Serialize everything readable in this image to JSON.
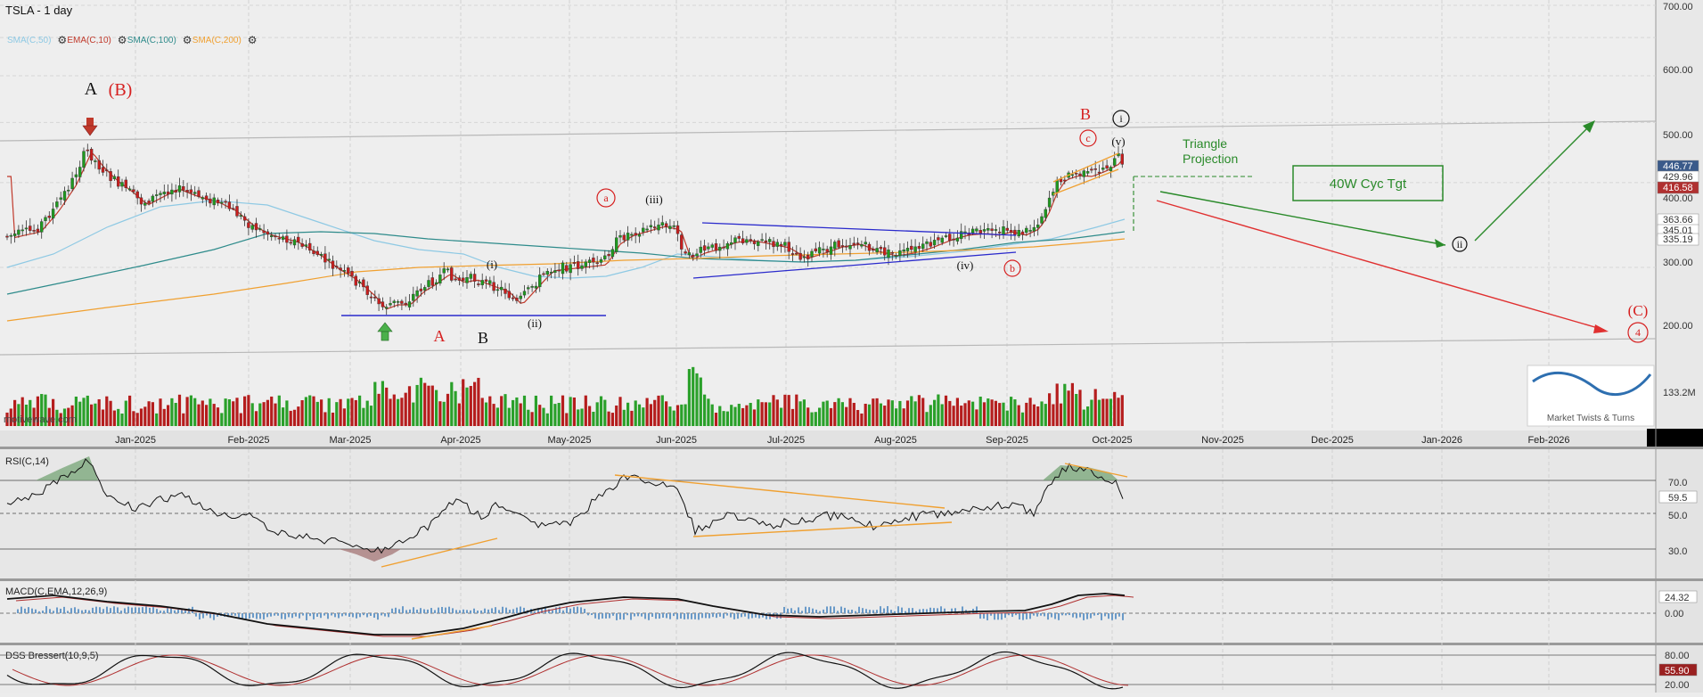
{
  "header": {
    "title": "TSLA - 1 day"
  },
  "indicators_legend": [
    {
      "label": "SMA(C,50)",
      "color": "#8ec9e4",
      "gear": false
    },
    {
      "label": "EMA(C,10)",
      "color": "#c0392b",
      "gear": true
    },
    {
      "label": "SMA(C,100)",
      "color": "#2e8b8b",
      "gear": true
    },
    {
      "label": "SMA(C,200)",
      "color": "#f0a030",
      "gear": true
    }
  ],
  "price_axis": {
    "ticks": [
      "700.00",
      "600.00",
      "500.00",
      "400.00",
      "300.00",
      "200.00",
      "133.2M"
    ],
    "boxes": [
      {
        "label": "446.77",
        "bg": "#3a5a8a",
        "fg": "#ffffff"
      },
      {
        "label": "429.96",
        "bg": "#ffffff",
        "fg": "#333333"
      },
      {
        "label": "416.58",
        "bg": "#b03030",
        "fg": "#ffffff"
      },
      {
        "label": "363.66",
        "bg": "#ffffff",
        "fg": "#333333"
      },
      {
        "label": "345.01",
        "bg": "#ffffff",
        "fg": "#333333"
      },
      {
        "label": "335.19",
        "bg": "#ffffff",
        "fg": "#333333"
      }
    ]
  },
  "time_axis": {
    "months": [
      "Jan-2025",
      "Feb-2025",
      "Mar-2025",
      "Apr-2025",
      "May-2025",
      "Jun-2025",
      "Jul-2025",
      "Aug-2025",
      "Sep-2025",
      "Oct-2025",
      "Nov-2025",
      "Dec-2025",
      "Jan-2026",
      "Feb-2026"
    ]
  },
  "watermark": "motivewave.com",
  "annotations": {
    "wave_labels": [
      {
        "text": "A",
        "color": "#111111"
      },
      {
        "text": "(B)",
        "color": "#d62020"
      },
      {
        "text": "A",
        "color": "#d62020"
      },
      {
        "text": "B",
        "color": "#111111"
      },
      {
        "text": "B",
        "color": "#d62020"
      },
      {
        "text": "(i)",
        "color": "#111111"
      },
      {
        "text": "(ii)",
        "color": "#111111"
      },
      {
        "text": "(iii)",
        "color": "#111111"
      },
      {
        "text": "(iv)",
        "color": "#111111"
      },
      {
        "text": "(v)",
        "color": "#111111"
      },
      {
        "text": "(C)",
        "color": "#d62020"
      }
    ],
    "circled_labels": [
      {
        "text": "a",
        "color": "#d62020"
      },
      {
        "text": "b",
        "color": "#d62020"
      },
      {
        "text": "c",
        "color": "#d62020"
      },
      {
        "text": "i",
        "color": "#111111"
      },
      {
        "text": "ii",
        "color": "#111111"
      },
      {
        "text": "4",
        "color": "#d62020"
      }
    ],
    "triangle_projection": "Triangle\nProjection",
    "cycle_target": "40W Cyc Tgt",
    "logo_text": "Market Twists & Turns"
  },
  "rsi_pane": {
    "title": "RSI(C,14)",
    "ticks": [
      "70.0",
      "50.0",
      "30.0"
    ],
    "current_box": "59.5"
  },
  "macd_pane": {
    "title": "MACD(C,EMA,12,26,9)",
    "ticks": [
      "0.00"
    ],
    "current_box": "24.32"
  },
  "dss_pane": {
    "title": "DSS Bressert(10,9,5)",
    "ticks": [
      "80.00",
      "20.00"
    ],
    "current_box": "55.90"
  },
  "chart_data": {
    "type": "candlestick",
    "title": "TSLA - 1 day",
    "x_range": [
      "2024-12-01",
      "2026-02-28"
    ],
    "y_range": [
      130,
      720
    ],
    "y_scale": "log",
    "series": [
      {
        "name": "TSLA",
        "kind": "ohlc",
        "dates": [
          "2024-12-02",
          "2024-12-09",
          "2024-12-16",
          "2024-12-23",
          "2024-12-30",
          "2025-01-06",
          "2025-01-13",
          "2025-01-20",
          "2025-01-27",
          "2025-02-03",
          "2025-02-10",
          "2025-02-17",
          "2025-02-24",
          "2025-03-03",
          "2025-03-10",
          "2025-03-17",
          "2025-03-24",
          "2025-03-31",
          "2025-04-07",
          "2025-04-14",
          "2025-04-21",
          "2025-04-28",
          "2025-05-05",
          "2025-05-12",
          "2025-05-19",
          "2025-05-26",
          "2025-06-02",
          "2025-06-09",
          "2025-06-16",
          "2025-06-23",
          "2025-06-30",
          "2025-07-07",
          "2025-07-14",
          "2025-07-21",
          "2025-07-28",
          "2025-08-04",
          "2025-08-11",
          "2025-08-18",
          "2025-08-25",
          "2025-09-02",
          "2025-09-08",
          "2025-09-15",
          "2025-09-22",
          "2025-09-29",
          "2025-10-03"
        ],
        "close": [
          330,
          358,
          418,
          452,
          403,
          392,
          398,
          410,
          405,
          360,
          352,
          345,
          300,
          265,
          240,
          250,
          265,
          255,
          245,
          235,
          270,
          285,
          290,
          340,
          345,
          355,
          300,
          325,
          322,
          310,
          318,
          305,
          320,
          310,
          325,
          330,
          335,
          320,
          345,
          345,
          392,
          415,
          420,
          440,
          430
        ]
      },
      {
        "name": "EMA(C,10)",
        "color": "#c0392b"
      },
      {
        "name": "SMA(C,50)",
        "color": "#8ec9e4"
      },
      {
        "name": "SMA(C,100)",
        "color": "#2e8b8b"
      },
      {
        "name": "SMA(C,200)",
        "color": "#f0a030"
      }
    ],
    "projections": [
      {
        "name": "bullish",
        "from": [
          "2025-10-06",
          400
        ],
        "via": [
          "2026-01-01",
          320
        ],
        "to": [
          "2026-02-15",
          525
        ],
        "color": "#2a8a2a"
      },
      {
        "name": "bearish",
        "from": [
          "2025-10-06",
          400
        ],
        "to": [
          "2026-02-15",
          198
        ],
        "color": "#e03030"
      }
    ]
  }
}
